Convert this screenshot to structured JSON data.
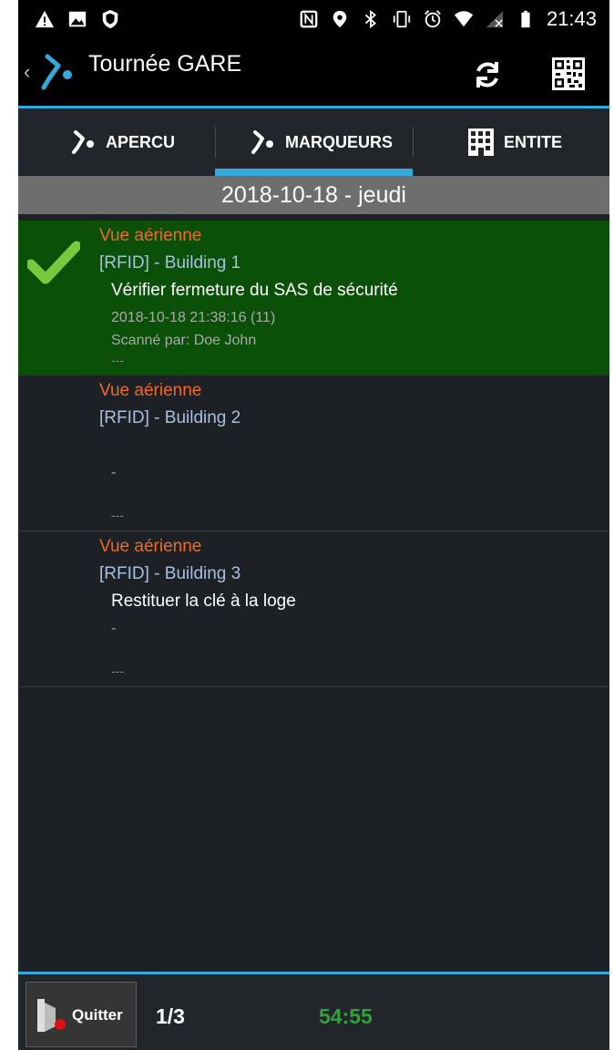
{
  "status_bar": {
    "left_icons": [
      "warning-icon",
      "image-icon",
      "shield-icon"
    ],
    "right_icons": [
      "nfc-icon",
      "location-icon",
      "bluetooth-icon",
      "vibrate-icon",
      "alarm-icon",
      "wifi-icon",
      "no-signal-icon",
      "battery-icon"
    ],
    "time": "21:43"
  },
  "app_bar": {
    "title": "Tournée GARE"
  },
  "tabs": [
    {
      "label": "APERCU",
      "selected": false
    },
    {
      "label": "MARQUEURS",
      "selected": true
    },
    {
      "label": "ENTITE",
      "selected": false
    }
  ],
  "date_header": "2018-10-18 - jeudi",
  "markers": [
    {
      "category": "Vue aérienne",
      "tag": "[RFID] - Building 1",
      "task": "Vérifier fermeture du SAS de sécurité",
      "date": "2018-10-18 21:38:16 (11)",
      "scanned": "Scanné par: Doe John",
      "separator": "---",
      "checked": true
    },
    {
      "category": "Vue aérienne",
      "tag": "[RFID] - Building 2",
      "task": "",
      "date": "-",
      "scanned": "",
      "separator": "---",
      "checked": false
    },
    {
      "category": "Vue aérienne",
      "tag": "[RFID] - Building 3",
      "task": "Restituer la clé à la loge",
      "date": "-",
      "scanned": "",
      "separator": "---",
      "checked": false
    }
  ],
  "bottom_bar": {
    "quit_label": "Quitter",
    "count": "1/3",
    "timer": "54:55"
  },
  "colors": {
    "accent": "#33a9dc",
    "checked_row": "#0b5009",
    "category": "#ef6a23",
    "tag": "#a9bfe0",
    "timer": "#33a03a"
  }
}
